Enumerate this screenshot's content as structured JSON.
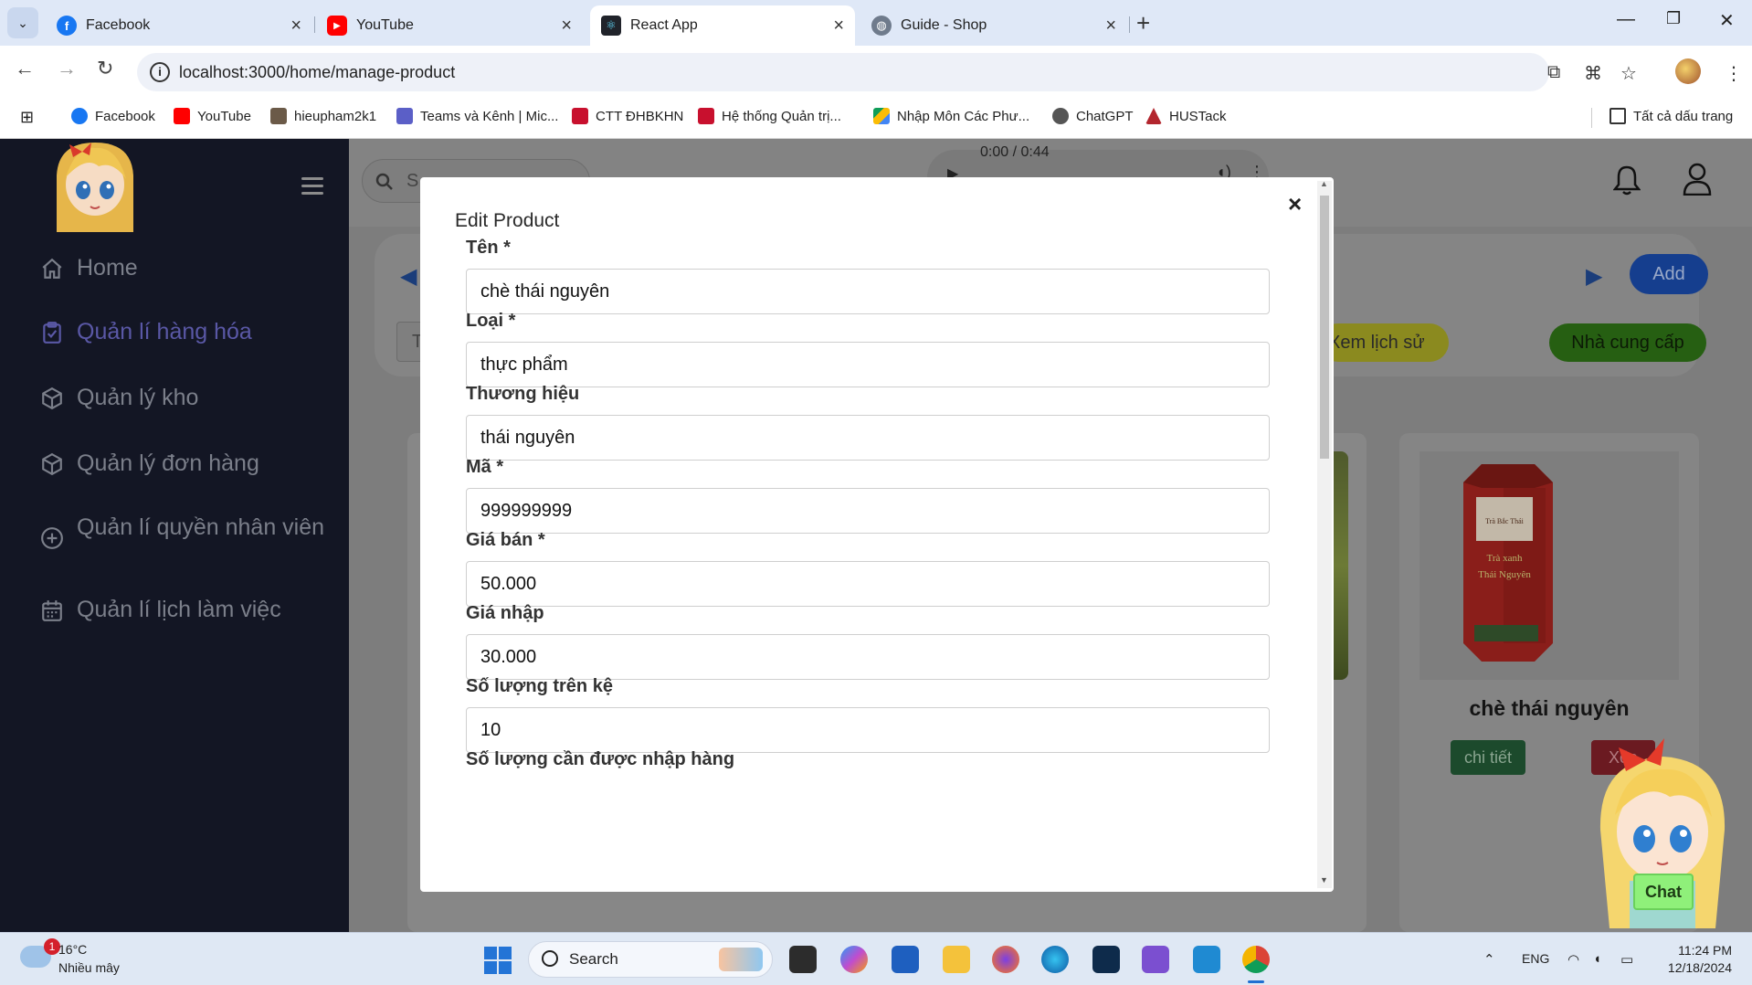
{
  "browser": {
    "tabs": [
      {
        "title": "Facebook",
        "icon": "facebook-icon"
      },
      {
        "title": "YouTube",
        "icon": "youtube-icon"
      },
      {
        "title": "React App",
        "icon": "react-icon",
        "active": true
      },
      {
        "title": "Guide - Shop",
        "icon": "globe-icon"
      }
    ],
    "url": "localhost:3000/home/manage-product",
    "bookmarks": [
      {
        "label": "Facebook",
        "icon": "facebook-icon"
      },
      {
        "label": "YouTube",
        "icon": "youtube-icon"
      },
      {
        "label": "hieupham2k1",
        "icon": "image-icon"
      },
      {
        "label": "Teams và Kênh | Mic...",
        "icon": "teams-icon"
      },
      {
        "label": "CTT ĐHBKHN",
        "icon": "ctt-icon"
      },
      {
        "label": "Hệ thống Quản trị...",
        "icon": "ctt-icon"
      },
      {
        "label": "Nhập Môn Các Phư...",
        "icon": "drive-icon"
      },
      {
        "label": "ChatGPT",
        "icon": "chatgpt-icon"
      },
      {
        "label": "HUSTack",
        "icon": "hustack-icon"
      }
    ],
    "all_bookmarks": "Tất cả dấu trang"
  },
  "sidebar": {
    "items": [
      {
        "label": "Home",
        "icon": "home-icon"
      },
      {
        "label": "Quản lí hàng hóa",
        "icon": "clipboard-icon",
        "active": true
      },
      {
        "label": "Quản lý kho",
        "icon": "box-icon"
      },
      {
        "label": "Quản lý đơn hàng",
        "icon": "box-icon"
      },
      {
        "label": "Quản lí quyền nhân viên",
        "icon": "plus-circle-icon"
      },
      {
        "label": "Quản lí lịch làm việc",
        "icon": "calendar-icon"
      }
    ]
  },
  "topbar": {
    "search_placeholder": "S",
    "media_time": "0:00 / 0:44"
  },
  "toolbar": {
    "add_label": "Add",
    "history_label": "Xem lịch sử",
    "supplier_label": "Nhà cung cấp",
    "filter_placeholder": "T"
  },
  "product_card": {
    "title": "chè thái nguyên",
    "detail_label": "chi tiết",
    "delete_label": "Xóa",
    "package_text": [
      "Trà Bắc Thái",
      "Trà xanh",
      "Thái Nguyên"
    ]
  },
  "modal": {
    "title": "Edit Product",
    "close": "×",
    "fields": [
      {
        "label": "Tên *",
        "value": "chè thái nguyên"
      },
      {
        "label": "Loại *",
        "value": "thực phẩm"
      },
      {
        "label": "Thương hiệu",
        "value": "thái nguyên"
      },
      {
        "label": "Mã *",
        "value": "999999999"
      },
      {
        "label": "Giá bán *",
        "value": "50.000"
      },
      {
        "label": "Giá nhập",
        "value": "30.000"
      },
      {
        "label": "Số lượng trên kệ",
        "value": "10"
      },
      {
        "label": "Số lượng cần được nhập hàng",
        "value": ""
      }
    ]
  },
  "chat": {
    "label": "Chat"
  },
  "taskbar": {
    "weather_temp": "16°C",
    "weather_condition": "Nhiều mây",
    "weather_badge": "1",
    "search_label": "Search",
    "language": "ENG",
    "time": "11:24 PM",
    "date": "12/18/2024"
  }
}
